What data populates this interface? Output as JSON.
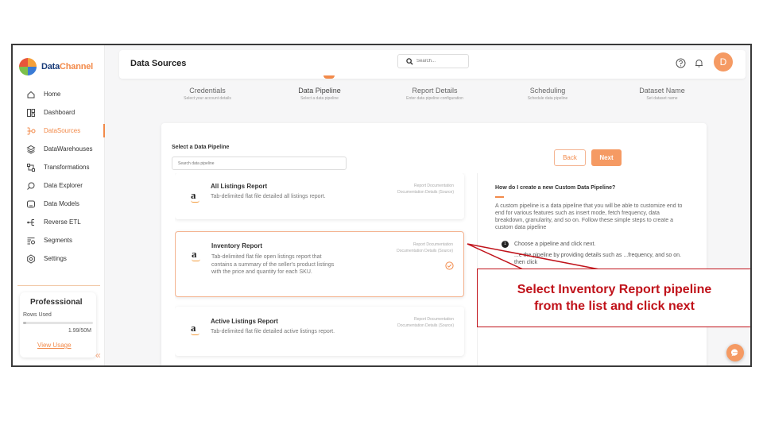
{
  "app": {
    "logo_data": "Data",
    "logo_channel": "Channel"
  },
  "sidebar": {
    "items": [
      {
        "label": "Home",
        "icon": "home-icon"
      },
      {
        "label": "Dashboard",
        "icon": "dashboard-icon"
      },
      {
        "label": "DataSources",
        "icon": "datasources-icon",
        "active": true
      },
      {
        "label": "DataWarehouses",
        "icon": "database-icon"
      },
      {
        "label": "Transformations",
        "icon": "transform-icon"
      },
      {
        "label": "Data Explorer",
        "icon": "explorer-icon"
      },
      {
        "label": "Data Models",
        "icon": "models-icon"
      },
      {
        "label": "Reverse ETL",
        "icon": "reverse-etl-icon"
      },
      {
        "label": "Segments",
        "icon": "segments-icon"
      },
      {
        "label": "Settings",
        "icon": "settings-icon"
      }
    ],
    "plan": {
      "title": "Professsional",
      "rows_label": "Rows Used",
      "usage": "1.99/50M",
      "usage_fraction": 0.04,
      "link": "View Usage"
    },
    "collapse": "«"
  },
  "header": {
    "title": "Data Sources",
    "search_placeholder": "Search...",
    "avatar": "D"
  },
  "stepper": [
    {
      "title": "Credentials",
      "sub": "Select your account details"
    },
    {
      "title": "Data Pipeline",
      "sub": "Select a data pipeline",
      "active": true
    },
    {
      "title": "Report Details",
      "sub": "Enter data pipeline configuration"
    },
    {
      "title": "Scheduling",
      "sub": "Schedule data pipeline"
    },
    {
      "title": "Dataset Name",
      "sub": "Set dataset name"
    }
  ],
  "panel": {
    "label": "Select a Data Pipeline",
    "search_placeholder": "Search data pipeline",
    "back": "Back",
    "next": "Next"
  },
  "pipelines": [
    {
      "logo": "a",
      "title": "All Listings Report",
      "desc": "Tab-delimited flat file detailed all listings report.",
      "link1": "Report Documentation",
      "link2": "Documentation Details (Source)"
    },
    {
      "logo": "a",
      "title": "Inventory Report",
      "desc": "Tab-delimited flat file open listings report that contains a summary of the seller's product listings with the price and quantity for each SKU.",
      "link1": "Report Documentation",
      "link2": "Documentation Details (Source)",
      "selected": true
    },
    {
      "logo": "a",
      "title": "Active Listings Report",
      "desc": "Tab-delimited flat file detailed active listings report.",
      "link1": "Report Documentation",
      "link2": "Documentation Details (Source)"
    }
  ],
  "info": {
    "title": "How do I create a new Custom Data Pipeline?",
    "body": "A custom pipeline is a data pipeline that you will be able to customize end to end for various features such as insert mode, fetch frequency, data breakdown, granularity, and so on. Follow these simple steps to create a custom data pipeline",
    "step1_num": "1",
    "step1": "Choose a pipeline and click next.",
    "step2": "...e the pipeline by providing details such as ...frequency, and so on. then click"
  },
  "annotation": {
    "line1": "Select Inventory Report pipeline",
    "line2": "from the list and click next"
  },
  "colors": {
    "accent": "#f28a4a",
    "callout": "#c0121a"
  }
}
